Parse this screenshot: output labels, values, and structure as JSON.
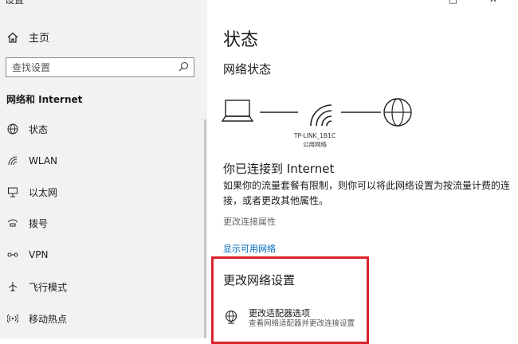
{
  "window": {
    "title": "设置",
    "controls": "— □ ✕"
  },
  "sidebar": {
    "home_label": "主页",
    "search_placeholder": "查找设置",
    "section_title": "网络和 Internet",
    "items": [
      {
        "label": "状态",
        "icon": "globe-icon"
      },
      {
        "label": "WLAN",
        "icon": "wifi-icon"
      },
      {
        "label": "以太网",
        "icon": "ethernet-icon"
      },
      {
        "label": "拨号",
        "icon": "dialup-icon"
      },
      {
        "label": "VPN",
        "icon": "vpn-icon"
      },
      {
        "label": "飞行模式",
        "icon": "airplane-icon"
      },
      {
        "label": "移动热点",
        "icon": "hotspot-icon"
      }
    ]
  },
  "main": {
    "title": "状态",
    "network_status_heading": "网络状态",
    "network_name": "TP-LINK_1B1C",
    "network_type": "公用网络",
    "connected_heading": "你已连接到 Internet",
    "connected_description": "如果你的流量套餐有限制，则你可以将此网络设置为按流量计费的连接，或者更改其他属性。",
    "change_connection_properties": "更改连接属性",
    "show_available_networks": "显示可用网络",
    "change_network_settings_heading": "更改网络设置",
    "adapter_options_label": "更改适配器选项",
    "adapter_options_desc": "查看网络适配器并更改连接设置"
  },
  "colors": {
    "accent_link": "#0067b8",
    "highlight_border": "#d9232c",
    "sidebar_bg": "#f2f2f2"
  }
}
